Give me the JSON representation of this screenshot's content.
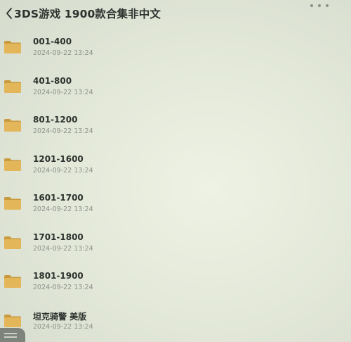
{
  "header": {
    "back_icon": "chevron-left-icon",
    "title": "3DS游戏 1900款合集非中文",
    "more_icon": "more-dots-icon"
  },
  "items": [
    {
      "name": "001-400",
      "date": "2024-09-22 13:24",
      "icon": "folder-icon"
    },
    {
      "name": "401-800",
      "date": "2024-09-22 13:24",
      "icon": "folder-icon"
    },
    {
      "name": "801-1200",
      "date": "2024-09-22 13:24",
      "icon": "folder-icon"
    },
    {
      "name": "1201-1600",
      "date": "2024-09-22 13:24",
      "icon": "folder-icon"
    },
    {
      "name": "1601-1700",
      "date": "2024-09-22 13:24",
      "icon": "folder-icon"
    },
    {
      "name": "1701-1800",
      "date": "2024-09-22 13:24",
      "icon": "folder-icon"
    },
    {
      "name": "1801-1900",
      "date": "2024-09-22 13:24",
      "icon": "folder-icon"
    },
    {
      "name": "坦克骑警 美版",
      "date": "2024-09-22 13:24",
      "icon": "folder-icon"
    }
  ],
  "colors": {
    "folder": "#e3b65a",
    "folder_dark": "#c99a3e",
    "title_text": "#2f3430",
    "date_text": "#8d938b"
  }
}
